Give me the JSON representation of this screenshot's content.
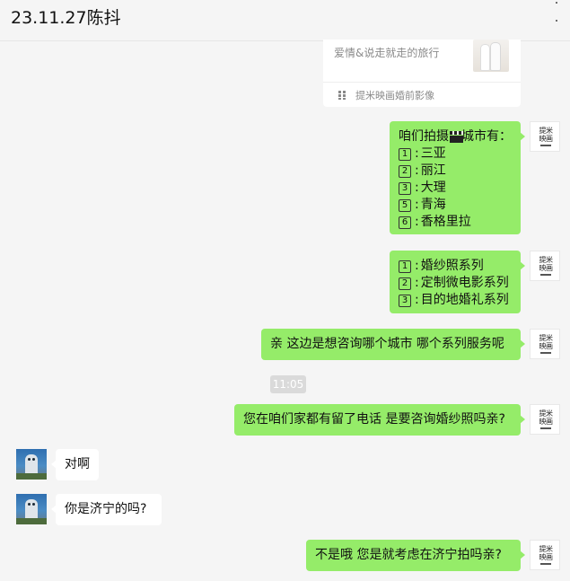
{
  "chat": {
    "title": "23.11.27陈抖"
  },
  "link_card": {
    "description": "爱情&说走就走的旅行",
    "source": "提米映画婚前影像"
  },
  "brand_avatar": {
    "line1": "提米",
    "line2": "映画"
  },
  "messages": {
    "m1": {
      "intro_prefix": "咱们拍摄",
      "intro_suffix": "城市有：",
      "items": [
        {
          "num": "1",
          "text": "三亚"
        },
        {
          "num": "2",
          "text": "丽江"
        },
        {
          "num": "3",
          "text": "大理"
        },
        {
          "num": "5",
          "text": "青海"
        },
        {
          "num": "6",
          "text": "香格里拉"
        }
      ]
    },
    "m2": {
      "items": [
        {
          "num": "1",
          "text": "婚纱照系列"
        },
        {
          "num": "2",
          "text": "定制微电影系列"
        },
        {
          "num": "3",
          "text": "目的地婚礼系列"
        }
      ]
    },
    "m3": "亲  这边是想咨询哪个城市  哪个系列服务呢",
    "timestamp": "11:05",
    "m4": "您在咱们家都有留了电话 是要咨询婚纱照吗亲?",
    "m5": "对啊",
    "m6": "你是济宁的吗?",
    "m7": "不是哦  您是就考虑在济宁拍吗亲?"
  },
  "colors": {
    "outgoing_bubble": "#95ec69",
    "incoming_bubble": "#ffffff",
    "background": "#f5f5f5"
  }
}
